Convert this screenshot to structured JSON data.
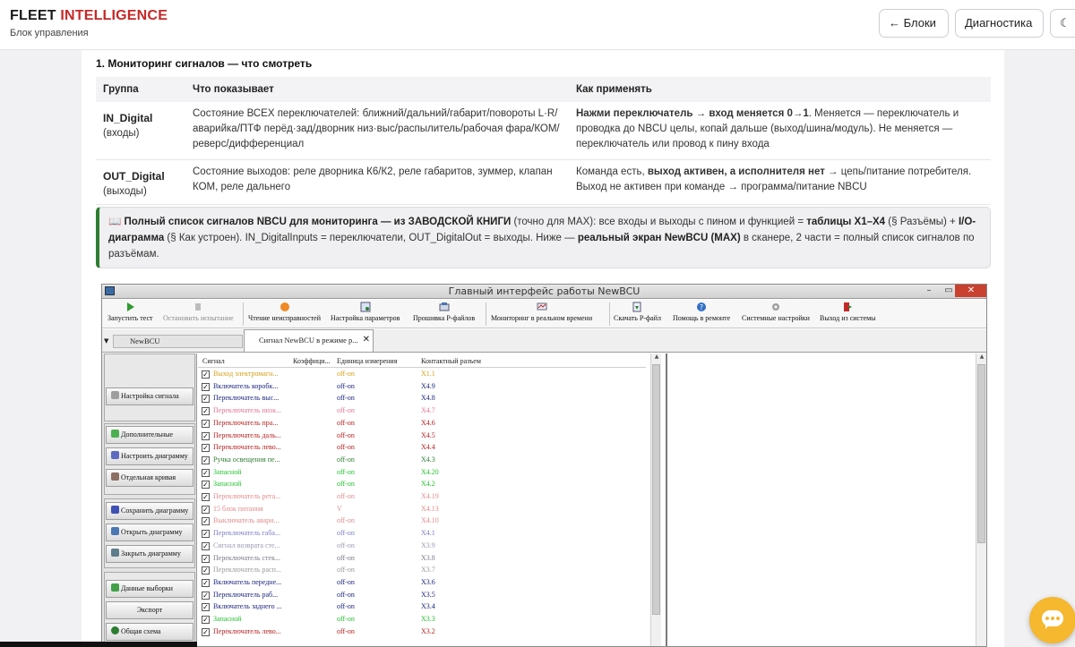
{
  "header": {
    "brand_part1": "FLEET",
    "brand_part2": "INTELLIGENCE",
    "subtitle": "Блок управления",
    "back_button": "← Блоки",
    "diag_button": "Диагностика",
    "theme_icon": "☾"
  },
  "section": {
    "title": "1. Мониторинг сигналов — что смотреть"
  },
  "table": {
    "headers": [
      "Группа",
      "Что показывает",
      "Как применять"
    ],
    "rows": [
      {
        "group": "IN_Digital",
        "group_sub": "(входы)",
        "shows": "Состояние ВСЕХ переключателей: ближний/дальний/габарит/повороты L·R/аварийка/ПТФ перёд·зад/дворник низ·выс/распылитель/рабочая фара/КОМ/реверс/дифференциал",
        "apply_bold": "Нажми переключатель → вход меняется 0→1",
        "apply_rest": ". Меняется — переключатель и проводка до NBCU целы, копай дальше (выход/шина/модуль). Не меняется — переключатель или провод к пину входа"
      },
      {
        "group": "OUT_Digital",
        "group_sub": "(выходы)",
        "shows": "Состояние выходов: реле дворника К6/К2, реле габаритов, зуммер, клапан КОМ, реле дальнего",
        "apply_pre": "Команда есть, ",
        "apply_bold": "выход активен, а исполнителя нет",
        "apply_rest": " → цепь/питание потребителя. Выход не активен при команде → программа/питание NBCU"
      }
    ]
  },
  "note": {
    "icon": "📖",
    "bold1": "Полный список сигналов NBCU для мониторинга — из ЗАВОДСКОЙ КНИГИ",
    "text1": " (точно для MAX): все входы и выходы с пином и функцией = ",
    "bold2": "таблицы X1–X4",
    "text2": " (§ Разъёмы) + ",
    "bold3": "I/O-диаграмма",
    "text3": " (§ Как устроен). IN_DigitalInputs = переключатели, OUT_DigitalOut = выходы. Ниже — ",
    "bold4": "реальный экран NewBCU (MAX)",
    "text4": " в сканере, 2 части = полный список сигналов по разъёмам."
  },
  "app": {
    "window_title": "Главный интерфейс работы NewBCU",
    "win_min": "–",
    "win_max": "▭",
    "win_close": "✕",
    "toolbar": {
      "start": "Запустить тест",
      "stop": "Остановить испытание",
      "read_faults": "Чтение неисправностей",
      "params": "Настройка параметров",
      "flash": "Прошивка P-файлов",
      "monitor": "Мониторинг в реальном времени",
      "download": "Скачать P-файл",
      "help": "Помощь в ремонте",
      "settings": "Системные настройки",
      "exit": "Выход из системы"
    },
    "tabs": {
      "tab1": "NewBCU",
      "tab2": "Сигнал NewBCU в режиме р...",
      "tab2_close": "✕",
      "arrow": "▼"
    },
    "left_buttons": {
      "signal_settings": "Настройка сигнала",
      "additional": "Дополнительные",
      "setup_diagram": "Настроить диаграмму",
      "single_curve": "Отдельная кривая",
      "save_diagram": "Сохранить диаграмму",
      "open_diagram": "Открыть диаграмму",
      "close_diagram": "Закрыть диаграмму",
      "sample_data": "Данные выборки",
      "export": "Экспорт",
      "overview": "Общая схема"
    },
    "grid_headers": {
      "signal": "Сигнал",
      "coef": "Коэффици...",
      "unit": "Единица измерения",
      "connector": "Контактный разъем"
    },
    "signals": [
      {
        "name": "Выход электромагн...",
        "unit": "off-on",
        "pin": "X1.1",
        "color": "#d4a017"
      },
      {
        "name": "Включатель коробк...",
        "unit": "off-on",
        "pin": "X4.9",
        "color": "#1a237e"
      },
      {
        "name": "Переключатель выс...",
        "unit": "off-on",
        "pin": "X4.8",
        "color": "#1a237e"
      },
      {
        "name": "Переключатель низк...",
        "unit": "off-on",
        "pin": "X4.7",
        "color": "#e57395"
      },
      {
        "name": "Переключатель пра...",
        "unit": "off-on",
        "pin": "X4.6",
        "color": "#b71c1c"
      },
      {
        "name": "Переключатель даль...",
        "unit": "off-on",
        "pin": "X4.5",
        "color": "#b71c1c"
      },
      {
        "name": "Переключатель лево...",
        "unit": "off-on",
        "pin": "X4.4",
        "color": "#b71c1c"
      },
      {
        "name": "Ручка освещения пе...",
        "unit": "off-on",
        "pin": "X4.3",
        "color": "#2e7d32"
      },
      {
        "name": "Запасной",
        "unit": "off-on",
        "pin": "X4.20",
        "color": "#22c22e"
      },
      {
        "name": "Запасной",
        "unit": "off-on",
        "pin": "X4.2",
        "color": "#22c22e"
      },
      {
        "name": "Переключатель рета...",
        "unit": "off-on",
        "pin": "X4.19",
        "color": "#e48a8a"
      },
      {
        "name": "15 блок питания",
        "unit": "V",
        "pin": "X4.13",
        "color": "#e48a8a"
      },
      {
        "name": "Выключатель авари...",
        "unit": "off-on",
        "pin": "X4.10",
        "color": "#e48a8a"
      },
      {
        "name": "Переключатель габа...",
        "unit": "off-on",
        "pin": "X4.1",
        "color": "#7a7fc4"
      },
      {
        "name": "Сигнал возврата сте...",
        "unit": "off-on",
        "pin": "X3.9",
        "color": "#9a9ab5"
      },
      {
        "name": "Переключатель стек...",
        "unit": "off-on",
        "pin": "X3.8",
        "color": "#7a7a8a"
      },
      {
        "name": "Переключатель расп...",
        "unit": "off-on",
        "pin": "X3.7",
        "color": "#9a9a9a"
      },
      {
        "name": "Включатель передне...",
        "unit": "off-on",
        "pin": "X3.6",
        "color": "#1a237e"
      },
      {
        "name": "Переключатель раб...",
        "unit": "off-on",
        "pin": "X3.5",
        "color": "#1a237e"
      },
      {
        "name": "Включатель заднего ...",
        "unit": "off-on",
        "pin": "X3.4",
        "color": "#1a237e"
      },
      {
        "name": "Запасной",
        "unit": "off-on",
        "pin": "X3.3",
        "color": "#22c22e"
      },
      {
        "name": "Переключатель лево...",
        "unit": "off-on",
        "pin": "X3.2",
        "color": "#b71c1c"
      }
    ]
  }
}
